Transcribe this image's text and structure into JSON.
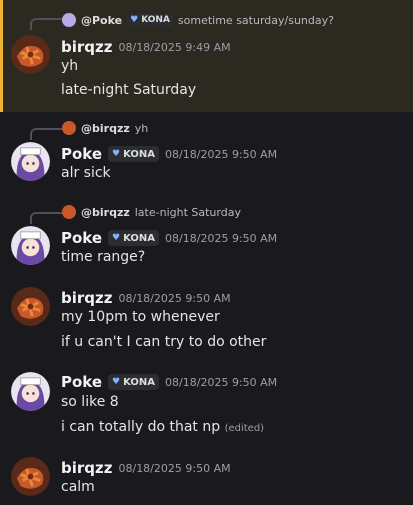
{
  "messages": [
    {
      "reply": {
        "name": "@Poke",
        "tag": "KONA",
        "text": "sometime saturday/sunday?"
      },
      "author": "birqzz",
      "timestamp": "08/18/2025 9:49 AM",
      "lines": [
        "yh",
        "late-night Saturday"
      ]
    },
    {
      "reply": {
        "name": "@birqzz",
        "text": "yh"
      },
      "author": "Poke",
      "tag": "KONA",
      "timestamp": "08/18/2025 9:50 AM",
      "lines": [
        "alr sick"
      ]
    },
    {
      "reply": {
        "name": "@birqzz",
        "text": "late-night Saturday"
      },
      "author": "Poke",
      "tag": "KONA",
      "timestamp": "08/18/2025 9:50 AM",
      "lines": [
        "time range?"
      ]
    },
    {
      "author": "birqzz",
      "timestamp": "08/18/2025 9:50 AM",
      "lines": [
        "my 10pm to whenever",
        "if u can't I can try to do other"
      ]
    },
    {
      "author": "Poke",
      "tag": "KONA",
      "timestamp": "08/18/2025 9:50 AM",
      "lines": [
        "so like 8",
        "i can totally do that np"
      ],
      "edited": "(edited)"
    },
    {
      "author": "birqzz",
      "timestamp": "08/18/2025 9:50 AM",
      "lines": [
        "calm"
      ]
    }
  ],
  "colors": {
    "background": "#1a1a1e",
    "highlight": "#2c2a20",
    "highlight_border": "#f0b232",
    "tag_heart": "#7fb3ff"
  },
  "icons": {
    "birqzz_avatar": "food-avatar-icon",
    "poke_avatar": "anime-girl-avatar-icon",
    "tag_badge": "heart-icon"
  }
}
